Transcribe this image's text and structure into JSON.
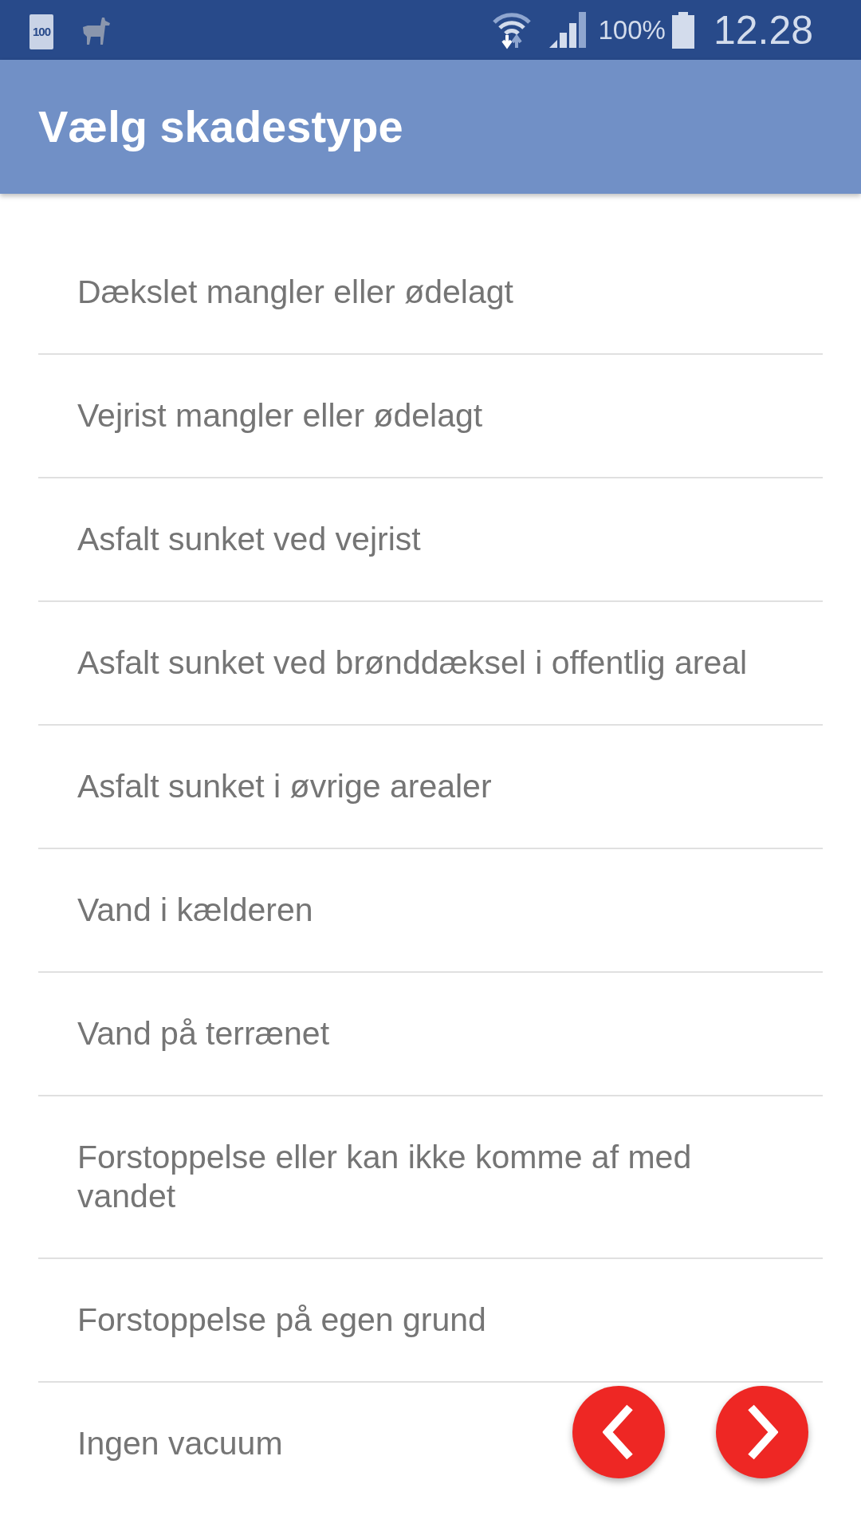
{
  "status_bar": {
    "battery_badge": "100",
    "battery_percent": "100%",
    "time": "12.28"
  },
  "app_bar": {
    "title": "Vælg skadestype"
  },
  "damage_types": [
    "Dækslet mangler eller ødelagt",
    "Vejrist mangler eller ødelagt",
    "Asfalt sunket ved vejrist",
    "Asfalt sunket ved brønddæksel i offentlig areal",
    "Asfalt sunket i øvrige arealer",
    "Vand i kælderen",
    "Vand på terrænet",
    "Forstoppelse eller kan ikke komme af med vandet",
    "Forstoppelse på egen grund",
    "Ingen vacuum"
  ],
  "nav_buttons": [
    {
      "kind": "previous"
    },
    {
      "kind": "next"
    }
  ]
}
